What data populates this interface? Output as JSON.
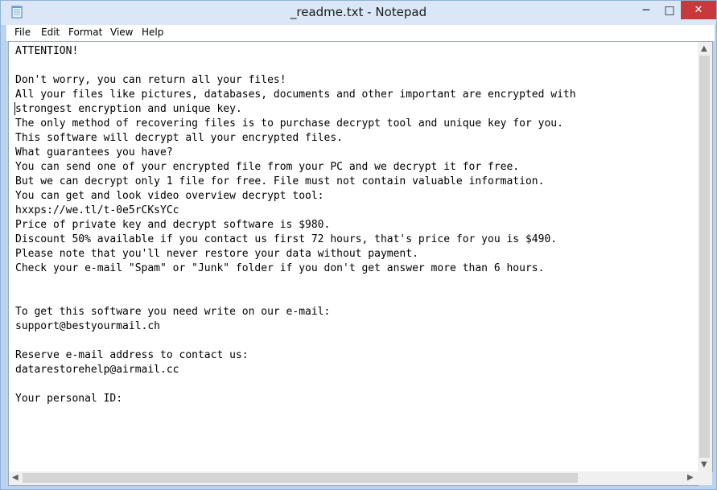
{
  "window": {
    "title": "_readme.txt - Notepad",
    "icon": "notepad-icon",
    "controls": {
      "minimize": "─",
      "maximize": "□",
      "close": "✕"
    }
  },
  "menu": {
    "items": [
      {
        "label": "File"
      },
      {
        "label": "Edit"
      },
      {
        "label": "Format"
      },
      {
        "label": "View"
      },
      {
        "label": "Help"
      }
    ]
  },
  "document": {
    "text": "ATTENTION!\n\nDon't worry, you can return all your files!\nAll your files like pictures, databases, documents and other important are encrypted with\nstrongest encryption and unique key.\nThe only method of recovering files is to purchase decrypt tool and unique key for you.\nThis software will decrypt all your encrypted files.\nWhat guarantees you have?\nYou can send one of your encrypted file from your PC and we decrypt it for free.\nBut we can decrypt only 1 file for free. File must not contain valuable information.\nYou can get and look video overview decrypt tool:\nhxxps://we.tl/t-0e5rCKsYCc\nPrice of private key and decrypt software is $980.\nDiscount 50% available if you contact us first 72 hours, that's price for you is $490.\nPlease note that you'll never restore your data without payment.\nCheck your e-mail \"Spam\" or \"Junk\" folder if you don't get answer more than 6 hours.\n\n\nTo get this software you need write on our e-mail:\nsupport@bestyourmail.ch\n\nReserve e-mail address to contact us:\ndatarestorehelp@airmail.cc\n\nYour personal ID:"
  },
  "scrollbars": {
    "up": "▲",
    "down": "▼",
    "left": "◀",
    "right": "▶"
  },
  "colors": {
    "titlebar": "#dbe7f6",
    "close_button": "#c7393b",
    "frame": "#bcd3ee"
  }
}
